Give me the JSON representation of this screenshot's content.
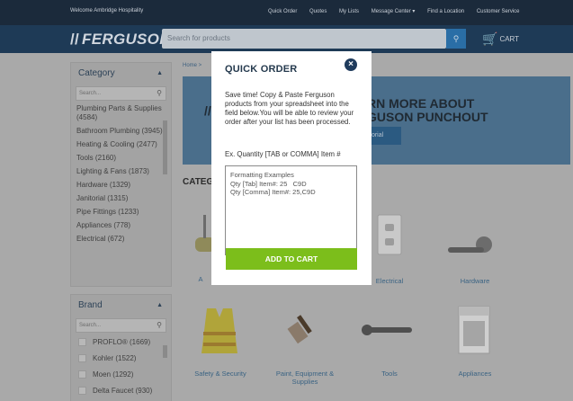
{
  "topbar": {
    "welcome": "Welcome Ambridge Hospitality",
    "links": [
      "Quick Order",
      "Quotes",
      "My Lists",
      "Message Center ▾",
      "Find a Location",
      "Customer Service"
    ]
  },
  "header": {
    "logo": "FERGUSON",
    "search_placeholder": "Search for products",
    "cart_label": "CART"
  },
  "breadcrumb": "Home >",
  "banner": {
    "line1": "RN MORE ABOUT",
    "line2": "GUSON PUNCHOUT",
    "button": "torial"
  },
  "categories_heading": "CATEG",
  "sidebar": {
    "category": {
      "title": "Category",
      "search_placeholder": "Search...",
      "items": [
        "Plumbing Parts & Supplies (4584)",
        "Bathroom Plumbing (3945)",
        "Heating & Cooling (2477)",
        "Tools (2160)",
        "Lighting & Fans (1873)",
        "Hardware (1329)",
        "Janitorial (1315)",
        "Pipe Fittings (1233)",
        "Appliances (778)",
        "Electrical (672)"
      ]
    },
    "brand": {
      "title": "Brand",
      "search_placeholder": "Search...",
      "items": [
        "PROFLO® (1669)",
        "Kohler (1522)",
        "Moen (1292)",
        "Delta Faucet (930)"
      ]
    }
  },
  "tiles": {
    "row1": [
      "Electrical",
      "Hardware"
    ],
    "row2": [
      "Safety & Security",
      "Paint, Equipment & Supplies",
      "Tools",
      "Appliances"
    ],
    "partial": "A"
  },
  "modal": {
    "title": "QUICK ORDER",
    "description": "Save time! Copy & Paste Ferguson products from your spreadsheet into the field below.You will be able to review your order after your list has been processed.",
    "example": "Ex. Quantity [TAB or COMMA] Item #",
    "placeholder": "Formatting Examples\nQty [Tab] Item#: 25   C9D\nQty [Comma] Item#: 25,C9D",
    "add_button": "ADD TO CART"
  },
  "colors": {
    "accent_green": "#7cbe1b",
    "brand_navy": "#1e3a56",
    "link_blue": "#3a6383"
  }
}
